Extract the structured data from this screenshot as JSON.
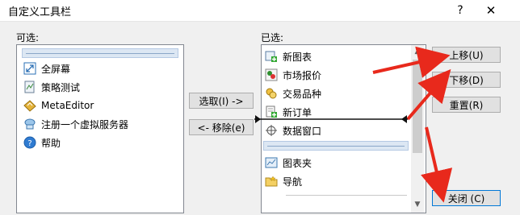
{
  "window": {
    "title": "自定义工具栏",
    "help_glyph": "?",
    "close_glyph": "✕"
  },
  "available": {
    "label": "可选:",
    "items": [
      {
        "label": "",
        "icon": "separator"
      },
      {
        "label": "全屏幕",
        "icon": "fullscreen-icon"
      },
      {
        "label": "策略测试",
        "icon": "strategy-tester-icon"
      },
      {
        "label": "MetaEditor",
        "icon": "metaeditor-icon"
      },
      {
        "label": "注册一个虚拟服务器",
        "icon": "virtual-server-icon"
      },
      {
        "label": "帮助",
        "icon": "help-icon"
      }
    ]
  },
  "selected": {
    "label": "已选:",
    "items": [
      {
        "label": "新图表",
        "icon": "new-chart-icon"
      },
      {
        "label": "市场报价",
        "icon": "market-watch-icon"
      },
      {
        "label": "交易品种",
        "icon": "symbols-icon"
      },
      {
        "label": "新订单",
        "icon": "new-order-icon"
      },
      {
        "label": "数据窗口",
        "icon": "data-window-icon"
      },
      {
        "label": "",
        "icon": "separator"
      },
      {
        "label": "图表夹",
        "icon": "chart-folder-icon"
      },
      {
        "label": "导航",
        "icon": "navigator-icon"
      }
    ]
  },
  "buttons": {
    "add": "选取(I) ->",
    "remove": "<- 移除(e)",
    "move_up": "上移(U)",
    "move_down": "下移(D)",
    "reset": "重置(R)",
    "close": "关闭 (C)"
  },
  "colors": {
    "annotation_arrow": "#e8291c",
    "focus_border": "#0078d7"
  }
}
